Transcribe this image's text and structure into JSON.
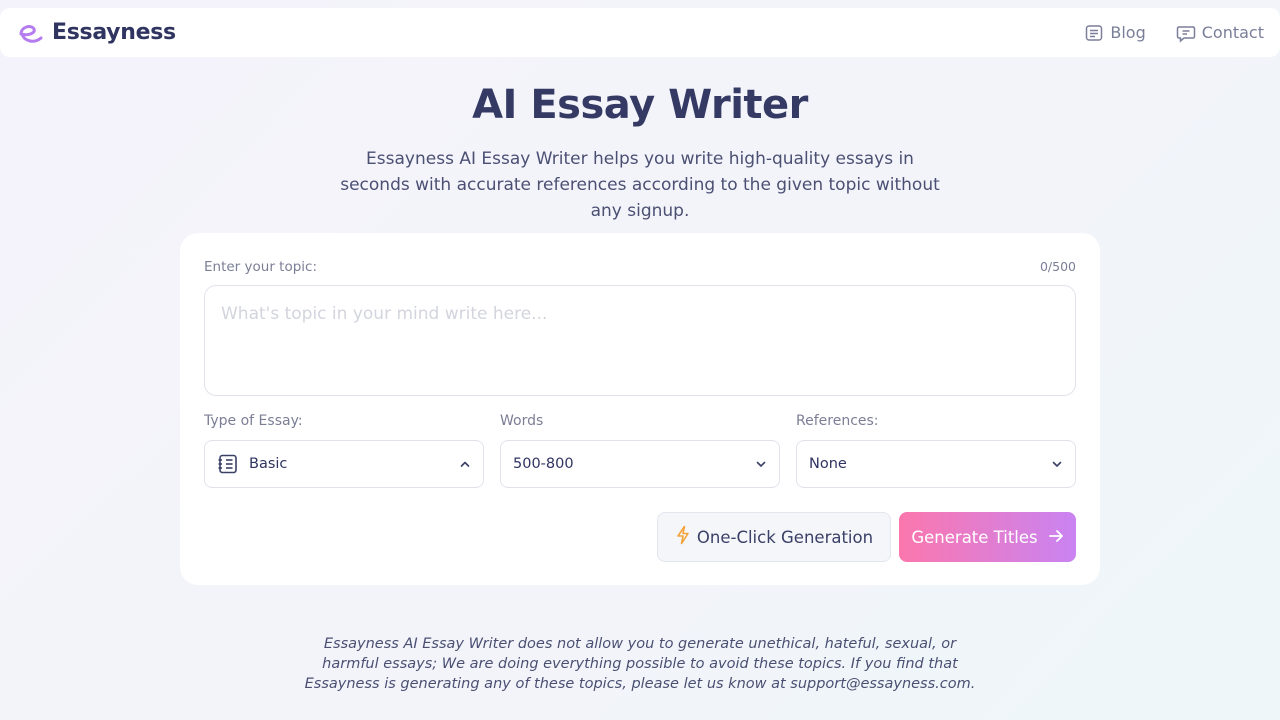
{
  "header": {
    "brand_name": "Essayness",
    "nav": [
      {
        "label": "Blog",
        "icon": "blog-icon"
      },
      {
        "label": "Contact",
        "icon": "chat-icon"
      }
    ]
  },
  "hero": {
    "title": "AI Essay Writer",
    "subtitle": "Essayness AI Essay Writer helps you write high-quality essays in seconds with accurate references according to the given topic without any signup."
  },
  "form": {
    "topic_label": "Enter your topic:",
    "counter": "0/500",
    "topic_value": "",
    "topic_placeholder": "What's topic in your mind write here...",
    "essay_type": {
      "label": "Type of Essay:",
      "value": "Basic",
      "icon": "essay-list-icon"
    },
    "words": {
      "label": "Words",
      "value": "500-800"
    },
    "references": {
      "label": "References:",
      "value": "None"
    },
    "one_click_label": "One-Click Generation",
    "generate_label": "Generate Titles"
  },
  "footer": {
    "disclaimer": "Essayness AI Essay Writer does not allow you to generate unethical, hateful, sexual, or harmful essays; We are doing everything possible to avoid these topics. If you find that Essayness is generating any of these topics, please let us know at support@essayness.com."
  },
  "colors": {
    "brand": "#b57cf0",
    "text_dark": "#2f3460",
    "gradient_start": "#fb77ad",
    "gradient_end": "#c983f2",
    "lightning": "#f3a33a"
  }
}
